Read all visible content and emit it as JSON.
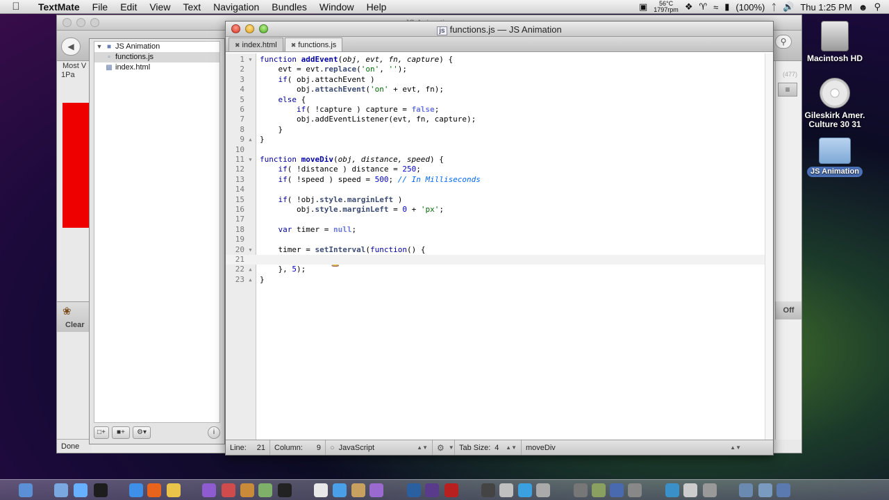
{
  "menubar": {
    "app_name": "TextMate",
    "items": [
      "File",
      "Edit",
      "View",
      "Text",
      "Navigation",
      "Bundles",
      "Window",
      "Help"
    ],
    "temperature": "56°C",
    "fan_rpm": "1797rpm",
    "battery": "(100%)",
    "clock": "Thu 1:25 PM"
  },
  "browser": {
    "title": "JS Animation",
    "bookmarks_label": "Most V",
    "tab_label": "1Pa",
    "count_text": "(477)",
    "off_label": "Off",
    "clear_label": "Clear",
    "status_text": "Done"
  },
  "drawer": {
    "project": "JS Animation",
    "files": [
      "functions.js",
      "index.html"
    ]
  },
  "editor": {
    "window_title": "functions.js — JS Animation",
    "title_icon": "js",
    "tabs": [
      "index.html",
      "functions.js"
    ],
    "active_tab": "functions.js",
    "current_line": 21,
    "lines": [
      [
        [
          "kw",
          "function "
        ],
        [
          "fn",
          "addEvent"
        ],
        [
          "",
          "("
        ],
        [
          "par",
          "obj, evt, fn, capture"
        ],
        [
          "",
          ") {"
        ]
      ],
      [
        [
          "",
          "    evt = evt."
        ],
        [
          "lib",
          "replace"
        ],
        [
          "",
          "("
        ],
        [
          "str",
          "'on'"
        ],
        [
          "",
          ", "
        ],
        [
          "str",
          "''"
        ],
        [
          "",
          ");"
        ]
      ],
      [
        [
          "",
          "    "
        ],
        [
          "kw",
          "if"
        ],
        [
          "",
          "( obj.attachEvent )"
        ]
      ],
      [
        [
          "",
          "        obj."
        ],
        [
          "lib",
          "attachEvent"
        ],
        [
          "",
          "("
        ],
        [
          "str",
          "'on'"
        ],
        [
          "",
          " + evt, fn);"
        ]
      ],
      [
        [
          "",
          "    "
        ],
        [
          "kw",
          "else"
        ],
        [
          "",
          " {"
        ]
      ],
      [
        [
          "",
          "        "
        ],
        [
          "kw",
          "if"
        ],
        [
          "",
          "( !capture ) capture = "
        ],
        [
          "cst",
          "false"
        ],
        [
          "",
          ";"
        ]
      ],
      [
        [
          "",
          "        obj.addEventListener(evt, fn, capture);"
        ]
      ],
      [
        [
          "",
          "    }"
        ]
      ],
      [
        [
          "",
          "}"
        ]
      ],
      [
        [
          "",
          ""
        ]
      ],
      [
        [
          "kw",
          "function "
        ],
        [
          "fn",
          "moveDiv"
        ],
        [
          "",
          "("
        ],
        [
          "par",
          "obj, distance, speed"
        ],
        [
          "",
          ") {"
        ]
      ],
      [
        [
          "",
          "    "
        ],
        [
          "kw",
          "if"
        ],
        [
          "",
          "( !distance ) distance = "
        ],
        [
          "num",
          "250"
        ],
        [
          "",
          ";"
        ]
      ],
      [
        [
          "",
          "    "
        ],
        [
          "kw",
          "if"
        ],
        [
          "",
          "( !speed ) speed = "
        ],
        [
          "num",
          "500"
        ],
        [
          "",
          "; "
        ],
        [
          "cmt",
          "// In Milliseconds"
        ]
      ],
      [
        [
          "",
          ""
        ]
      ],
      [
        [
          "",
          "    "
        ],
        [
          "kw",
          "if"
        ],
        [
          "",
          "( !obj."
        ],
        [
          "prop",
          "style"
        ],
        [
          "",
          "."
        ],
        [
          "prop",
          "marginLeft"
        ],
        [
          "",
          " )"
        ]
      ],
      [
        [
          "",
          "        obj."
        ],
        [
          "prop",
          "style"
        ],
        [
          "",
          "."
        ],
        [
          "prop",
          "marginLeft"
        ],
        [
          "",
          " = "
        ],
        [
          "num",
          "0"
        ],
        [
          "",
          " + "
        ],
        [
          "str",
          "'px'"
        ],
        [
          "",
          ";"
        ]
      ],
      [
        [
          "",
          ""
        ]
      ],
      [
        [
          "",
          "    "
        ],
        [
          "kw",
          "var"
        ],
        [
          "",
          " timer = "
        ],
        [
          "cst",
          "null"
        ],
        [
          "",
          ";"
        ]
      ],
      [
        [
          "",
          ""
        ]
      ],
      [
        [
          "",
          "    timer = "
        ],
        [
          "lib",
          "setInterval"
        ],
        [
          "",
          "("
        ],
        [
          "kw",
          "function"
        ],
        [
          "",
          "() {"
        ]
      ],
      [
        [
          "",
          ""
        ]
      ],
      [
        [
          "",
          "    }, "
        ],
        [
          "num",
          "5"
        ],
        [
          "",
          ");"
        ]
      ],
      [
        [
          "",
          "}"
        ]
      ]
    ],
    "fold_lines": [
      1,
      9,
      11,
      20,
      22,
      23
    ],
    "status": {
      "line_label": "Line:",
      "line_value": "21",
      "column_label": "Column:",
      "column_value": "9",
      "language": "JavaScript",
      "tab_size_label": "Tab Size:",
      "tab_size_value": "4",
      "symbol": "moveDiv"
    }
  },
  "desktop": {
    "icons": [
      {
        "name": "Macintosh HD",
        "kind": "hard-drive-icon"
      },
      {
        "name": "Gileskirk Amer. Culture 30 31",
        "kind": "dvd-icon"
      },
      {
        "name": "JS Animation",
        "kind": "folder-icon"
      }
    ]
  },
  "colors": {
    "keyword": "#0000a2",
    "string": "#036a07",
    "comment": "#0066ff",
    "constant": "#6d79de",
    "number": "#0000cd",
    "page_red": "#ee0000"
  }
}
